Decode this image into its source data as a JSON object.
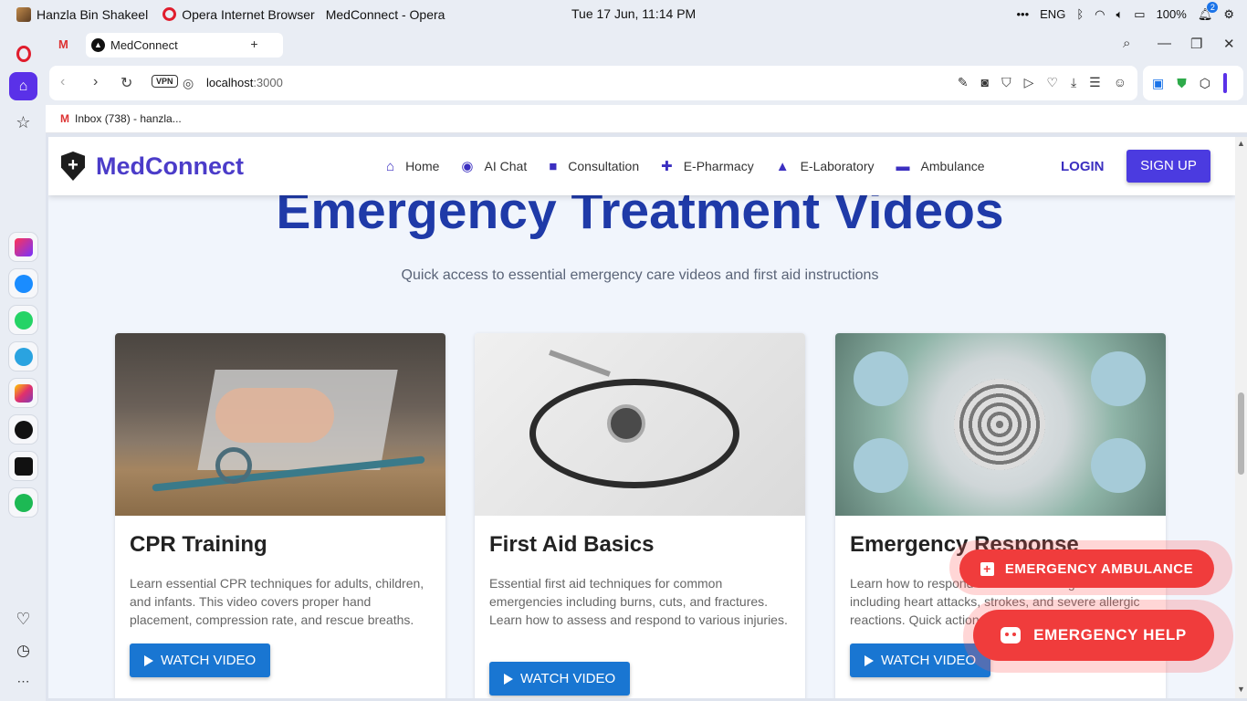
{
  "os": {
    "user": "Hanzla Bin Shakeel",
    "app": "Opera Internet Browser",
    "window_title": "MedConnect - Opera",
    "datetime": "Tue 17 Jun, 11:14 PM",
    "lang": "ENG",
    "battery": "100%",
    "notif_count": "2"
  },
  "browser": {
    "tab_title": "MedConnect",
    "vpn": "VPN",
    "url_host": "localhost",
    "url_port": ":3000",
    "bookmark": "Inbox (738) - hanzla..."
  },
  "site": {
    "brand": "MedConnect",
    "nav": [
      {
        "label": "Home"
      },
      {
        "label": "AI Chat"
      },
      {
        "label": "Consultation"
      },
      {
        "label": "E-Pharmacy"
      },
      {
        "label": "E-Laboratory"
      },
      {
        "label": "Ambulance"
      }
    ],
    "login": "LOGIN",
    "signup": "SIGN UP",
    "hero_title": "Emergency Treatment Videos",
    "hero_subtitle": "Quick access to essential emergency care videos and first aid instructions",
    "cards": [
      {
        "title": "CPR Training",
        "desc": "Learn essential CPR techniques for adults, children, and infants. This video covers proper hand placement, compression rate, and rescue breaths.",
        "button": "WATCH VIDEO"
      },
      {
        "title": "First Aid Basics",
        "desc": "Essential first aid techniques for common emergencies including burns, cuts, and fractures. Learn how to assess and respond to various injuries.",
        "button": "WATCH VIDEO"
      },
      {
        "title": "Emergency Response",
        "desc": "Learn how to respond to medical emergencies including heart attacks, strokes, and severe allergic reactions. Quick action saves lives.",
        "button": "WATCH VIDEO"
      }
    ],
    "emergency_ambulance": "EMERGENCY AMBULANCE",
    "emergency_help": "EMERGENCY HELP"
  }
}
